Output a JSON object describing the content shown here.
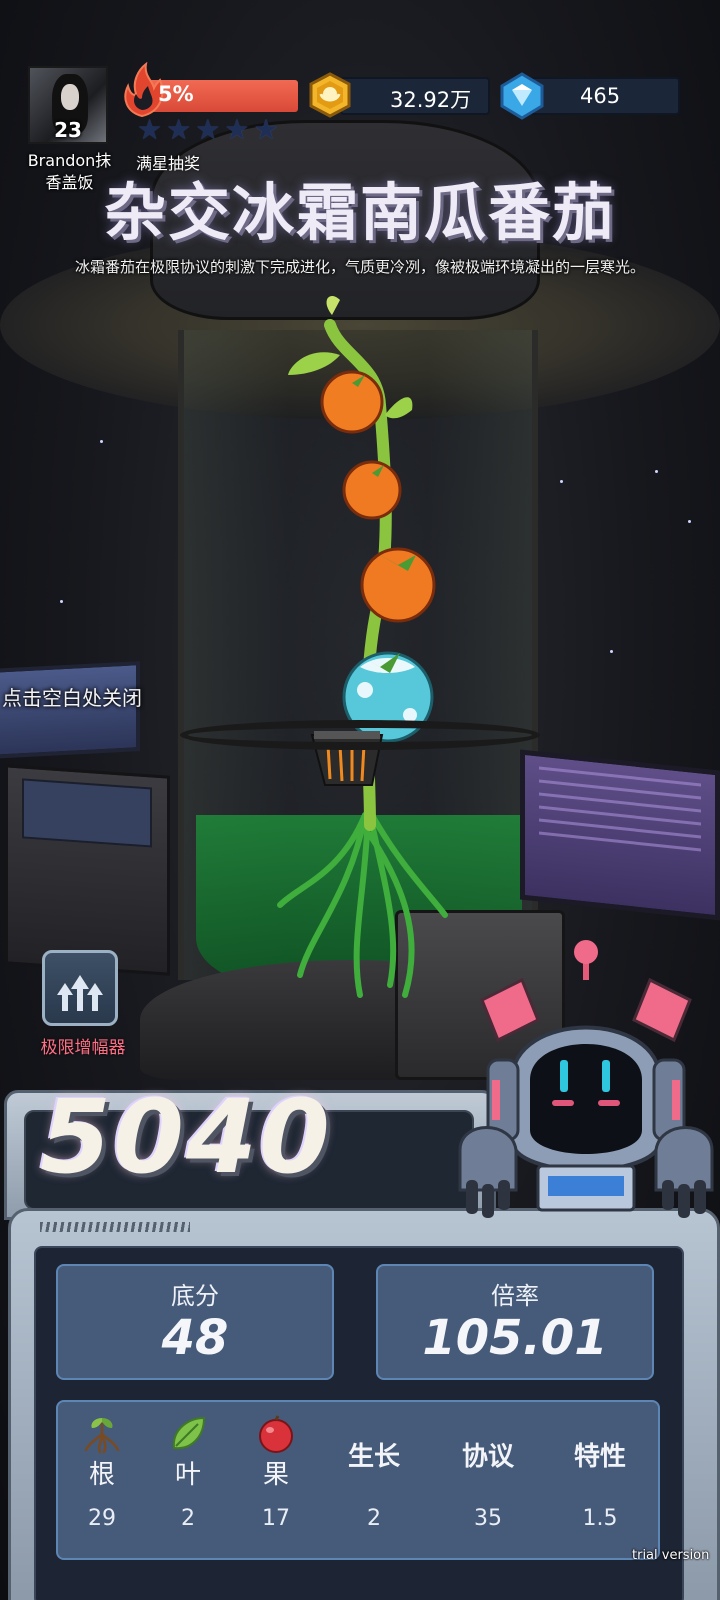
{
  "player": {
    "level": "23",
    "name_line1": "Brandon抹",
    "name_line2": "香盖饭"
  },
  "energy": {
    "percent_text": "5%",
    "percent": 5,
    "stars_filled": 0,
    "stars_total": 5,
    "lottery_label": "满星抽奖"
  },
  "currency": {
    "coins": "32.92万",
    "gems": "465"
  },
  "plant": {
    "title": "杂交冰霜南瓜番茄",
    "description": "冰霜番茄在极限协议的刺激下完成进化，气质更冷冽，像被极端环境凝出的一层寒光。"
  },
  "hints": {
    "close": "点击空白处关闭"
  },
  "amplifier": {
    "label": "极限增幅器"
  },
  "result": {
    "total_score": "5040",
    "base_label": "底分",
    "base_value": "48",
    "multiplier_label": "倍率",
    "multiplier_value": "105.01"
  },
  "attributes": [
    {
      "label": "根",
      "value": "29",
      "icon": "root-icon"
    },
    {
      "label": "叶",
      "value": "2",
      "icon": "leaf-icon"
    },
    {
      "label": "果",
      "value": "17",
      "icon": "fruit-icon"
    },
    {
      "label": "生长",
      "value": "2"
    },
    {
      "label": "协议",
      "value": "35"
    },
    {
      "label": "特性",
      "value": "1.5"
    }
  ],
  "watermark": "trial version",
  "colors": {
    "energy_fill": "#e0513c",
    "stat_box": "#465a79",
    "amp_label": "#ff6f86"
  }
}
